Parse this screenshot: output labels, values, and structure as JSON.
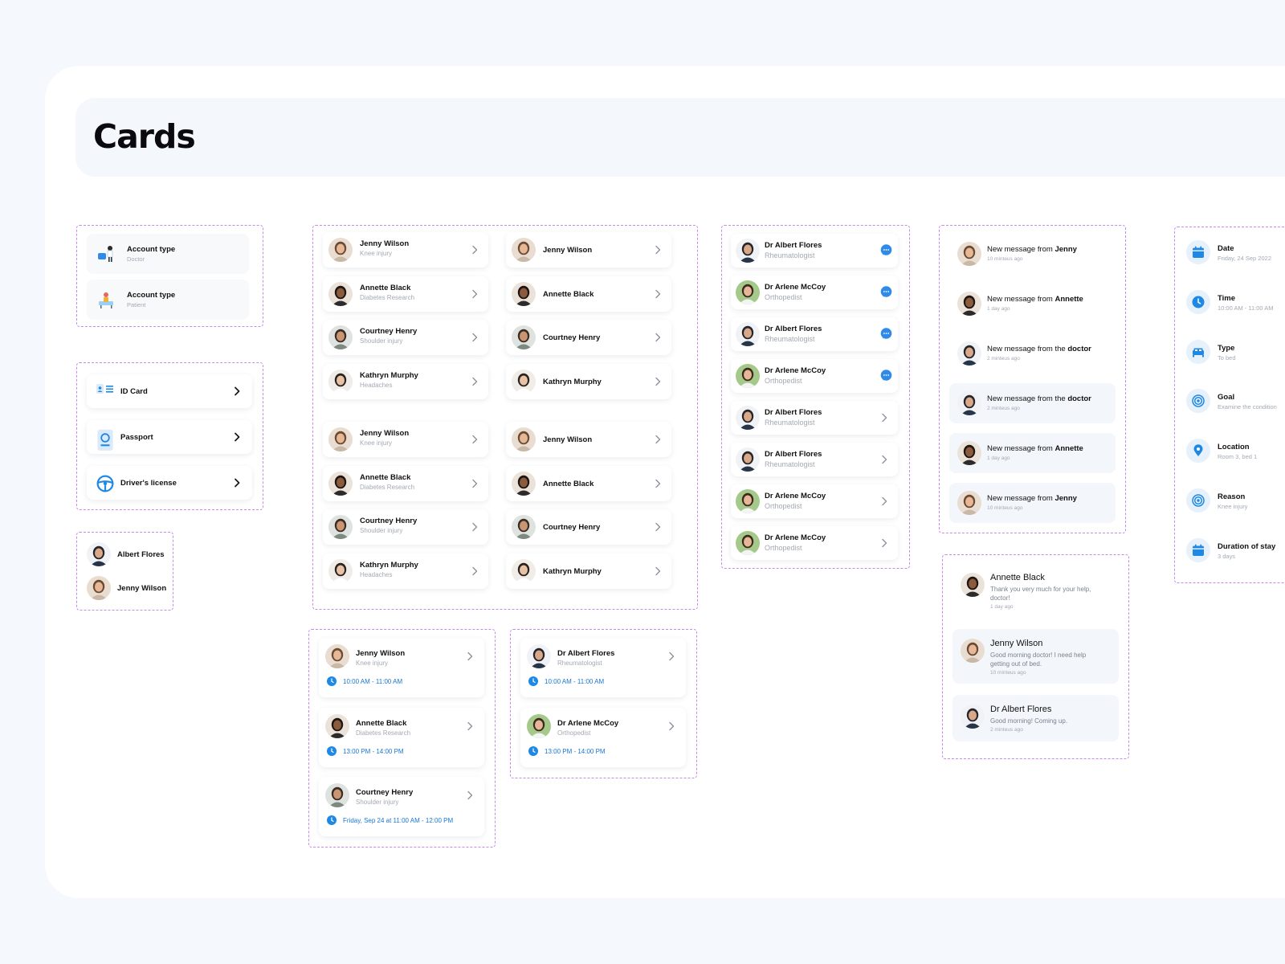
{
  "page": {
    "title": "Cards"
  },
  "account_cards": [
    {
      "title": "Account type",
      "subtitle": "Doctor"
    },
    {
      "title": "Account type",
      "subtitle": "Patient"
    }
  ],
  "document_cards": [
    {
      "label": "ID Card",
      "icon": "id-card-icon"
    },
    {
      "label": "Passport",
      "icon": "passport-icon"
    },
    {
      "label": "Driver's license",
      "icon": "steering-wheel-icon"
    }
  ],
  "compact_people": [
    {
      "name": "Albert Flores"
    },
    {
      "name": "Jenny Wilson"
    }
  ],
  "patients": [
    {
      "name": "Jenny Wilson",
      "detail": "Knee injury"
    },
    {
      "name": "Annette Black",
      "detail": "Diabetes Research"
    },
    {
      "name": "Courtney Henry",
      "detail": "Shoulder injury"
    },
    {
      "name": "Kathryn Murphy",
      "detail": "Headaches"
    }
  ],
  "doctors": [
    {
      "name": "Dr Albert Flores",
      "specialty": "Rheumatologist",
      "action": "chat"
    },
    {
      "name": "Dr Arlene McCoy",
      "specialty": "Orthopedist",
      "action": "chat"
    },
    {
      "name": "Dr Albert Flores",
      "specialty": "Rheumatologist",
      "action": "chat"
    },
    {
      "name": "Dr Arlene McCoy",
      "specialty": "Orthopedist",
      "action": "chat"
    },
    {
      "name": "Dr Albert Flores",
      "specialty": "Rheumatologist",
      "action": "arrow"
    },
    {
      "name": "Dr Albert Flores",
      "specialty": "Rheumatologist",
      "action": "arrow"
    },
    {
      "name": "Dr Arlene McCoy",
      "specialty": "Orthopedist",
      "action": "arrow"
    },
    {
      "name": "Dr Arlene McCoy",
      "specialty": "Orthopedist",
      "action": "arrow"
    }
  ],
  "patient_appointments": [
    {
      "name": "Jenny Wilson",
      "detail": "Knee injury",
      "time": "10:00 AM - 11:00 AM"
    },
    {
      "name": "Annette Black",
      "detail": "Diabetes Research",
      "time": "13:00 PM - 14:00 PM"
    },
    {
      "name": "Courtney Henry",
      "detail": "Shoulder injury",
      "time": "Friday, Sep 24 at 11:00 AM - 12:00 PM"
    }
  ],
  "doctor_appointments": [
    {
      "name": "Dr Albert Flores",
      "specialty": "Rheumatologist",
      "time": "10:00 AM - 11:00 AM"
    },
    {
      "name": "Dr Arlene McCoy",
      "specialty": "Orthopedist",
      "time": "13:00 PM - 14:00 PM"
    }
  ],
  "notifications": [
    {
      "prefix": "New message from ",
      "sender": "Jenny",
      "time": "10 minteus ago"
    },
    {
      "prefix": "New message from ",
      "sender": "Annette",
      "time": "1 day ago"
    },
    {
      "prefix": "New message from the ",
      "sender": "doctor",
      "time": "2 minteus ago"
    },
    {
      "prefix": "New message from the ",
      "sender": "doctor",
      "time": "2 minteus ago"
    },
    {
      "prefix": "New message from ",
      "sender": "Annette",
      "time": "1 day ago"
    },
    {
      "prefix": "New message from ",
      "sender": "Jenny",
      "time": "10 minteus ago"
    }
  ],
  "chats": [
    {
      "name": "Annette Black",
      "text": "Thank you very much for your help, doctor!",
      "time": "1 day ago"
    },
    {
      "name": "Jenny Wilson",
      "text": "Good morning doctor! I need help getting out of bed.",
      "time": "10 minteus ago"
    },
    {
      "name": "Dr Albert Flores",
      "text": "Good morning! Coming up.",
      "time": "2 minteus ago"
    }
  ],
  "details": [
    {
      "label": "Date",
      "value": "Friday, 24 Sep 2022",
      "icon": "calendar-icon"
    },
    {
      "label": "Time",
      "value": "10:00 AM - 11:00 AM",
      "icon": "clock-icon"
    },
    {
      "label": "Type",
      "value": "To bed",
      "icon": "bed-icon"
    },
    {
      "label": "Goal",
      "value": "Examine the condition",
      "icon": "target-icon"
    },
    {
      "label": "Location",
      "value": "Room 3, bed 1",
      "icon": "location-pin-icon"
    },
    {
      "label": "Reason",
      "value": "Knee injury",
      "icon": "target-icon"
    },
    {
      "label": "Duration of stay",
      "value": "3 days",
      "icon": "calendar-icon"
    }
  ],
  "colors": {
    "accent": "#1e88e5",
    "dashed_border": "#c987f2",
    "sheet": "#ffffff",
    "background": "#f5f8fc"
  }
}
